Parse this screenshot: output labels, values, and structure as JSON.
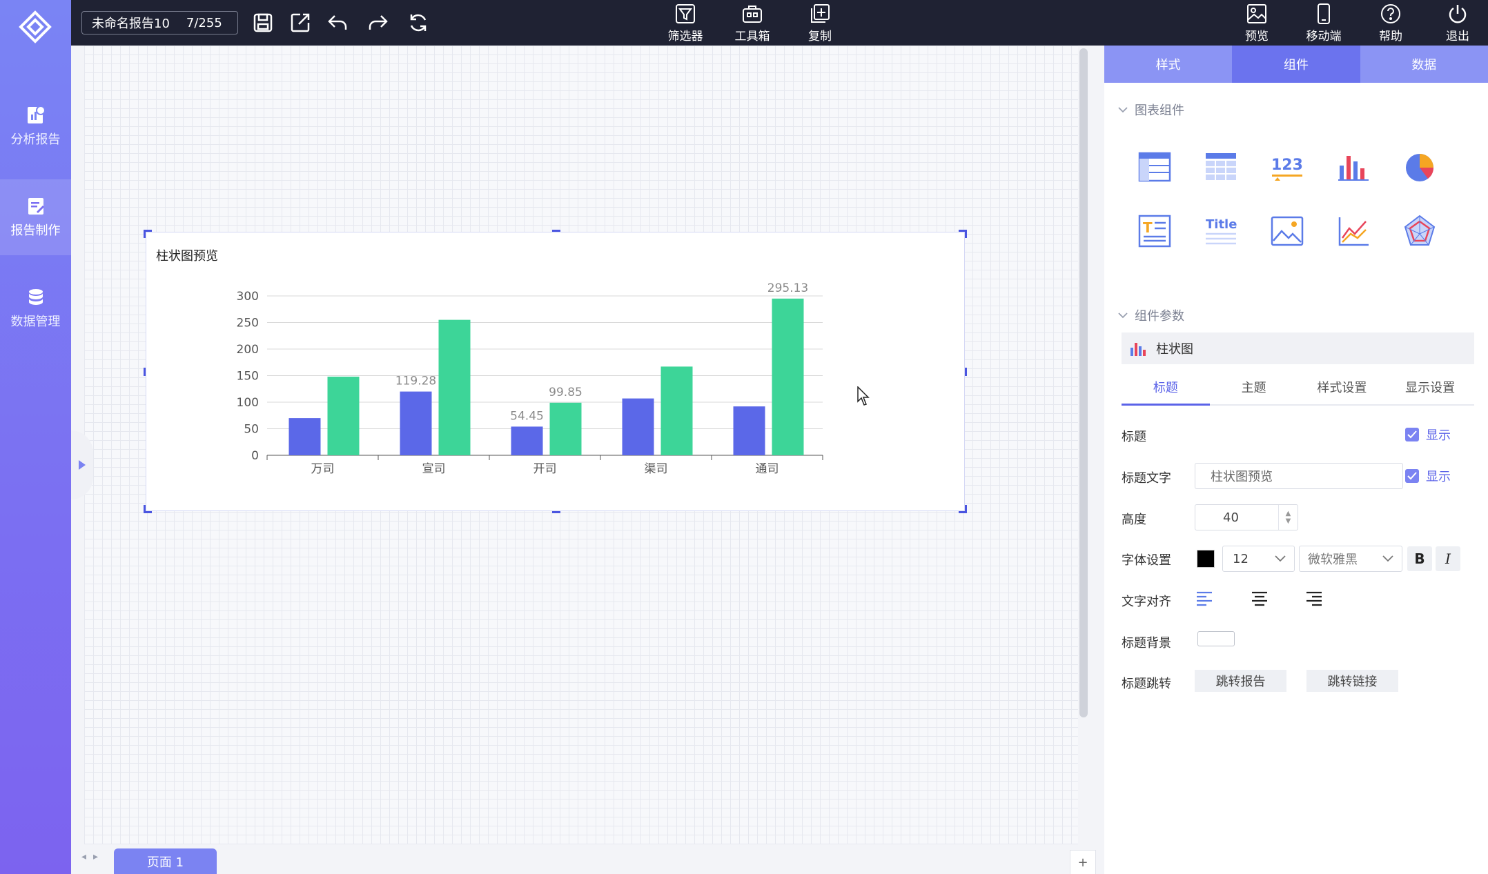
{
  "sidebar": {
    "items": [
      {
        "label": "分析报告",
        "icon": "report-chart-icon"
      },
      {
        "label": "报告制作",
        "icon": "edit-report-icon",
        "active": true
      },
      {
        "label": "数据管理",
        "icon": "database-icon"
      }
    ]
  },
  "topbar": {
    "doc_name": "未命名报告10",
    "page_counter": "7/255",
    "filter_label": "筛选器",
    "toolbox_label": "工具箱",
    "copy_label": "复制",
    "preview_label": "预览",
    "mobile_label": "移动端",
    "help_label": "帮助",
    "logout_label": "退出"
  },
  "canvas": {
    "page_tab": "页面 1",
    "add_page": "+"
  },
  "chart_data": {
    "type": "bar",
    "title": "柱状图预览",
    "categories": [
      "万司",
      "宣司",
      "开司",
      "渠司",
      "通司"
    ],
    "series": [
      {
        "values": [
          70,
          120,
          54,
          107,
          92
        ],
        "color": "#5b68e8"
      },
      {
        "values": [
          148,
          255,
          99,
          167,
          295
        ],
        "color": "#3dd598"
      }
    ],
    "data_labels": [
      {
        "series": 0,
        "index": 1,
        "text": "119.28"
      },
      {
        "series": 0,
        "index": 2,
        "text": "54.45"
      },
      {
        "series": 1,
        "index": 2,
        "text": "99.85"
      },
      {
        "series": 1,
        "index": 4,
        "text": "295.13"
      }
    ],
    "yticks": [
      "0",
      "50",
      "100",
      "150",
      "200",
      "250",
      "300"
    ],
    "ylim": [
      0,
      300
    ],
    "grid": true
  },
  "panel": {
    "tabs": [
      "样式",
      "组件",
      "数据"
    ],
    "active_tab": 1,
    "section_chart_components": "图表组件",
    "section_component_params": "组件参数",
    "chart_type_label": "柱状图",
    "sub_tabs": [
      "标题",
      "主题",
      "样式设置",
      "显示设置"
    ],
    "title_label": "标题",
    "show_label": "显示",
    "title_text_label": "标题文字",
    "title_text_value": "柱状图预览",
    "height_label": "高度",
    "height_value": "40",
    "font_label": "字体设置",
    "font_color": "#000000",
    "font_size": "12",
    "font_family": "微软雅黑",
    "bold_label": "B",
    "italic_label": "I",
    "align_label": "文字对齐",
    "title_bg_label": "标题背景",
    "title_jump_label": "标题跳转",
    "jump_report_label": "跳转报告",
    "jump_link_label": "跳转链接"
  }
}
